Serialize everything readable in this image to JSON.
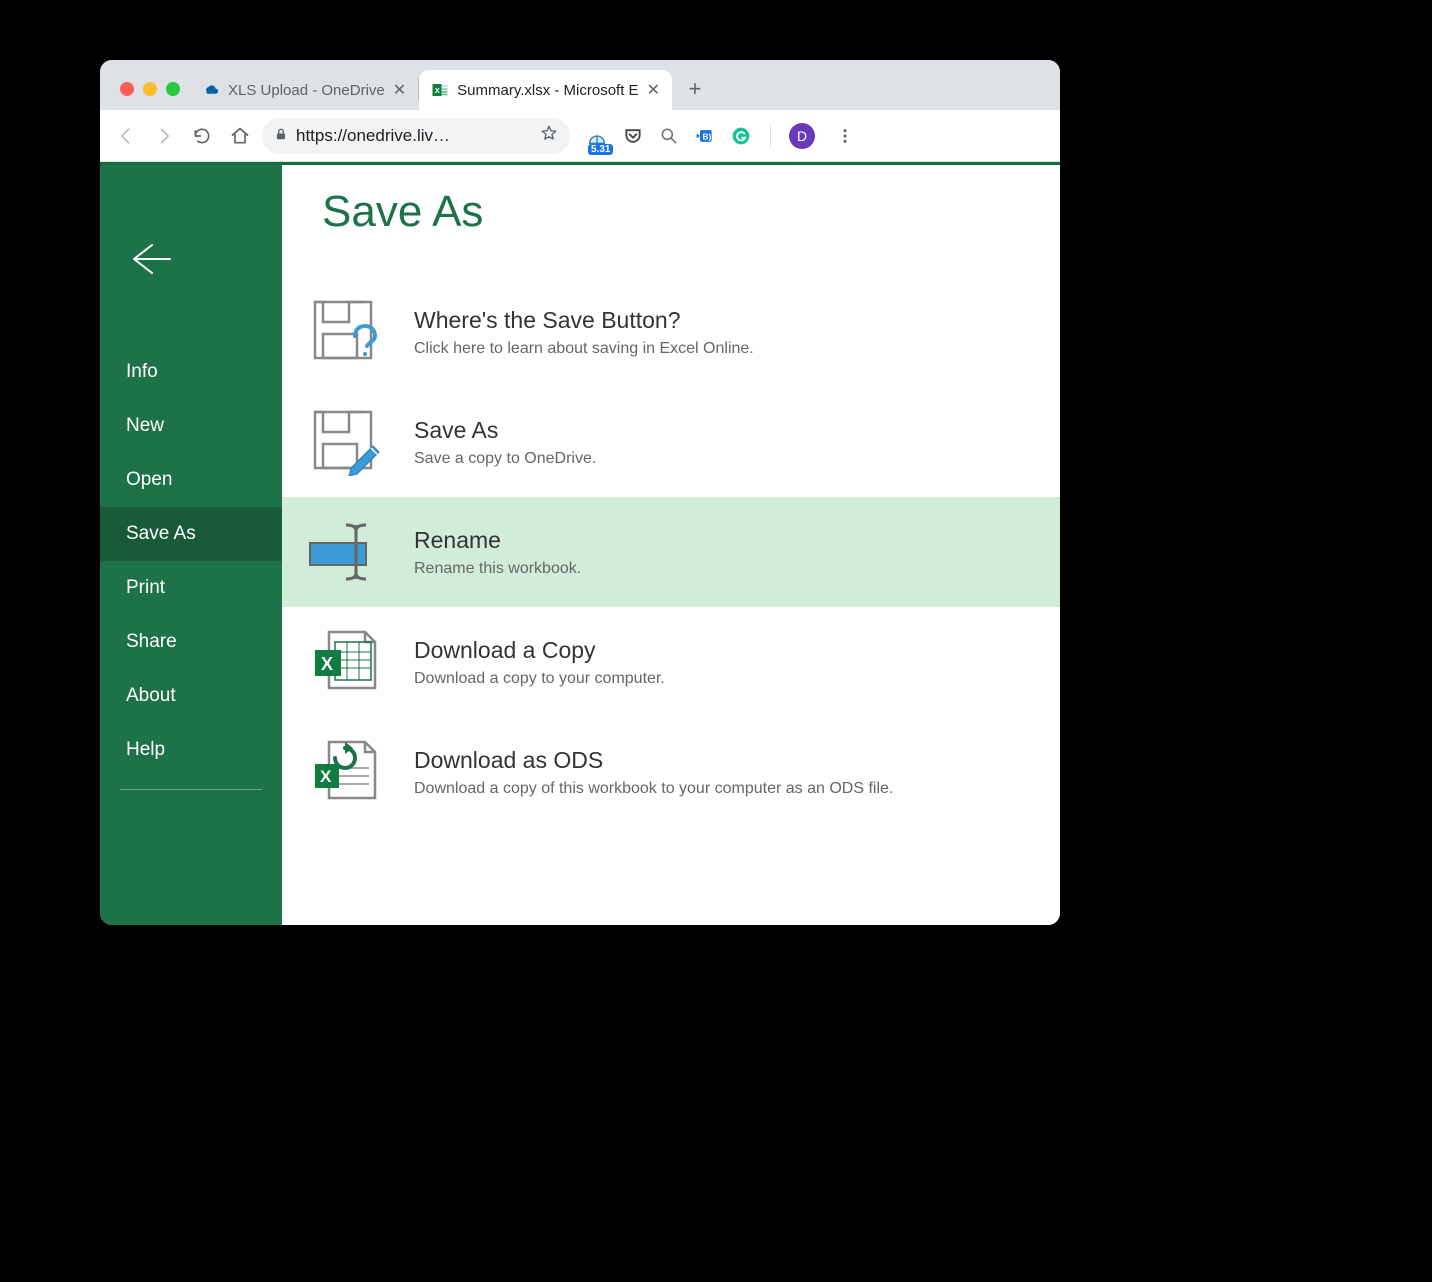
{
  "browser": {
    "tabs": [
      {
        "title": "XLS Upload - OneDrive",
        "active": false
      },
      {
        "title": "Summary.xlsx - Microsoft E",
        "active": true
      }
    ],
    "url": "https://onedrive.liv…",
    "avatar_initial": "D",
    "ext_badge": "5.31"
  },
  "page": {
    "heading": "Save As",
    "sidebar": {
      "items": [
        "Info",
        "New",
        "Open",
        "Save As",
        "Print",
        "Share",
        "About",
        "Help"
      ],
      "active_index": 3
    },
    "options": [
      {
        "title": "Where's the Save Button?",
        "desc": "Click here to learn about saving in Excel Online.",
        "icon": "save-question",
        "highlight": false
      },
      {
        "title": "Save As",
        "desc": "Save a copy to OneDrive.",
        "icon": "save-pencil",
        "highlight": false
      },
      {
        "title": "Rename",
        "desc": "Rename this workbook.",
        "icon": "rename",
        "highlight": true
      },
      {
        "title": "Download a Copy",
        "desc": "Download a copy to your computer.",
        "icon": "excel-doc",
        "highlight": false
      },
      {
        "title": "Download as ODS",
        "desc": "Download a copy of this workbook to your computer as an ODS file.",
        "icon": "excel-ods",
        "highlight": false
      }
    ]
  }
}
